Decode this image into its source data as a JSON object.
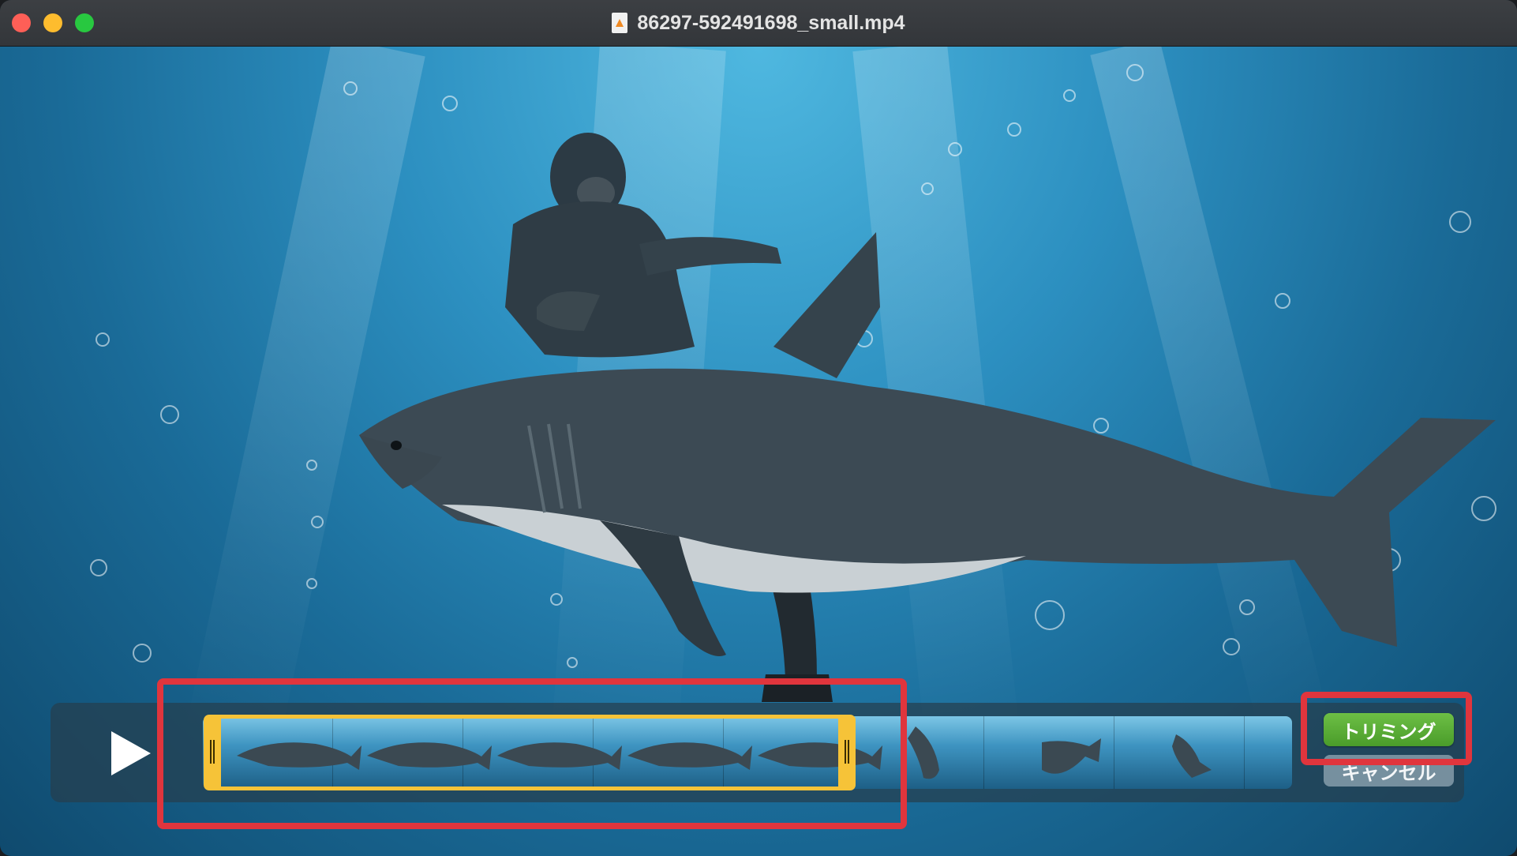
{
  "window": {
    "title": "86297-592491698_small.mp4",
    "file_icon": "m4v-file-icon"
  },
  "player": {
    "play_icon": "play-icon",
    "frames_count": 9,
    "trim_button_label": "トリミング",
    "cancel_button_label": "キャンセル"
  },
  "colors": {
    "trim_handles": "#f6c338",
    "trim_button": "#5aac35",
    "highlight": "#e0353d"
  }
}
